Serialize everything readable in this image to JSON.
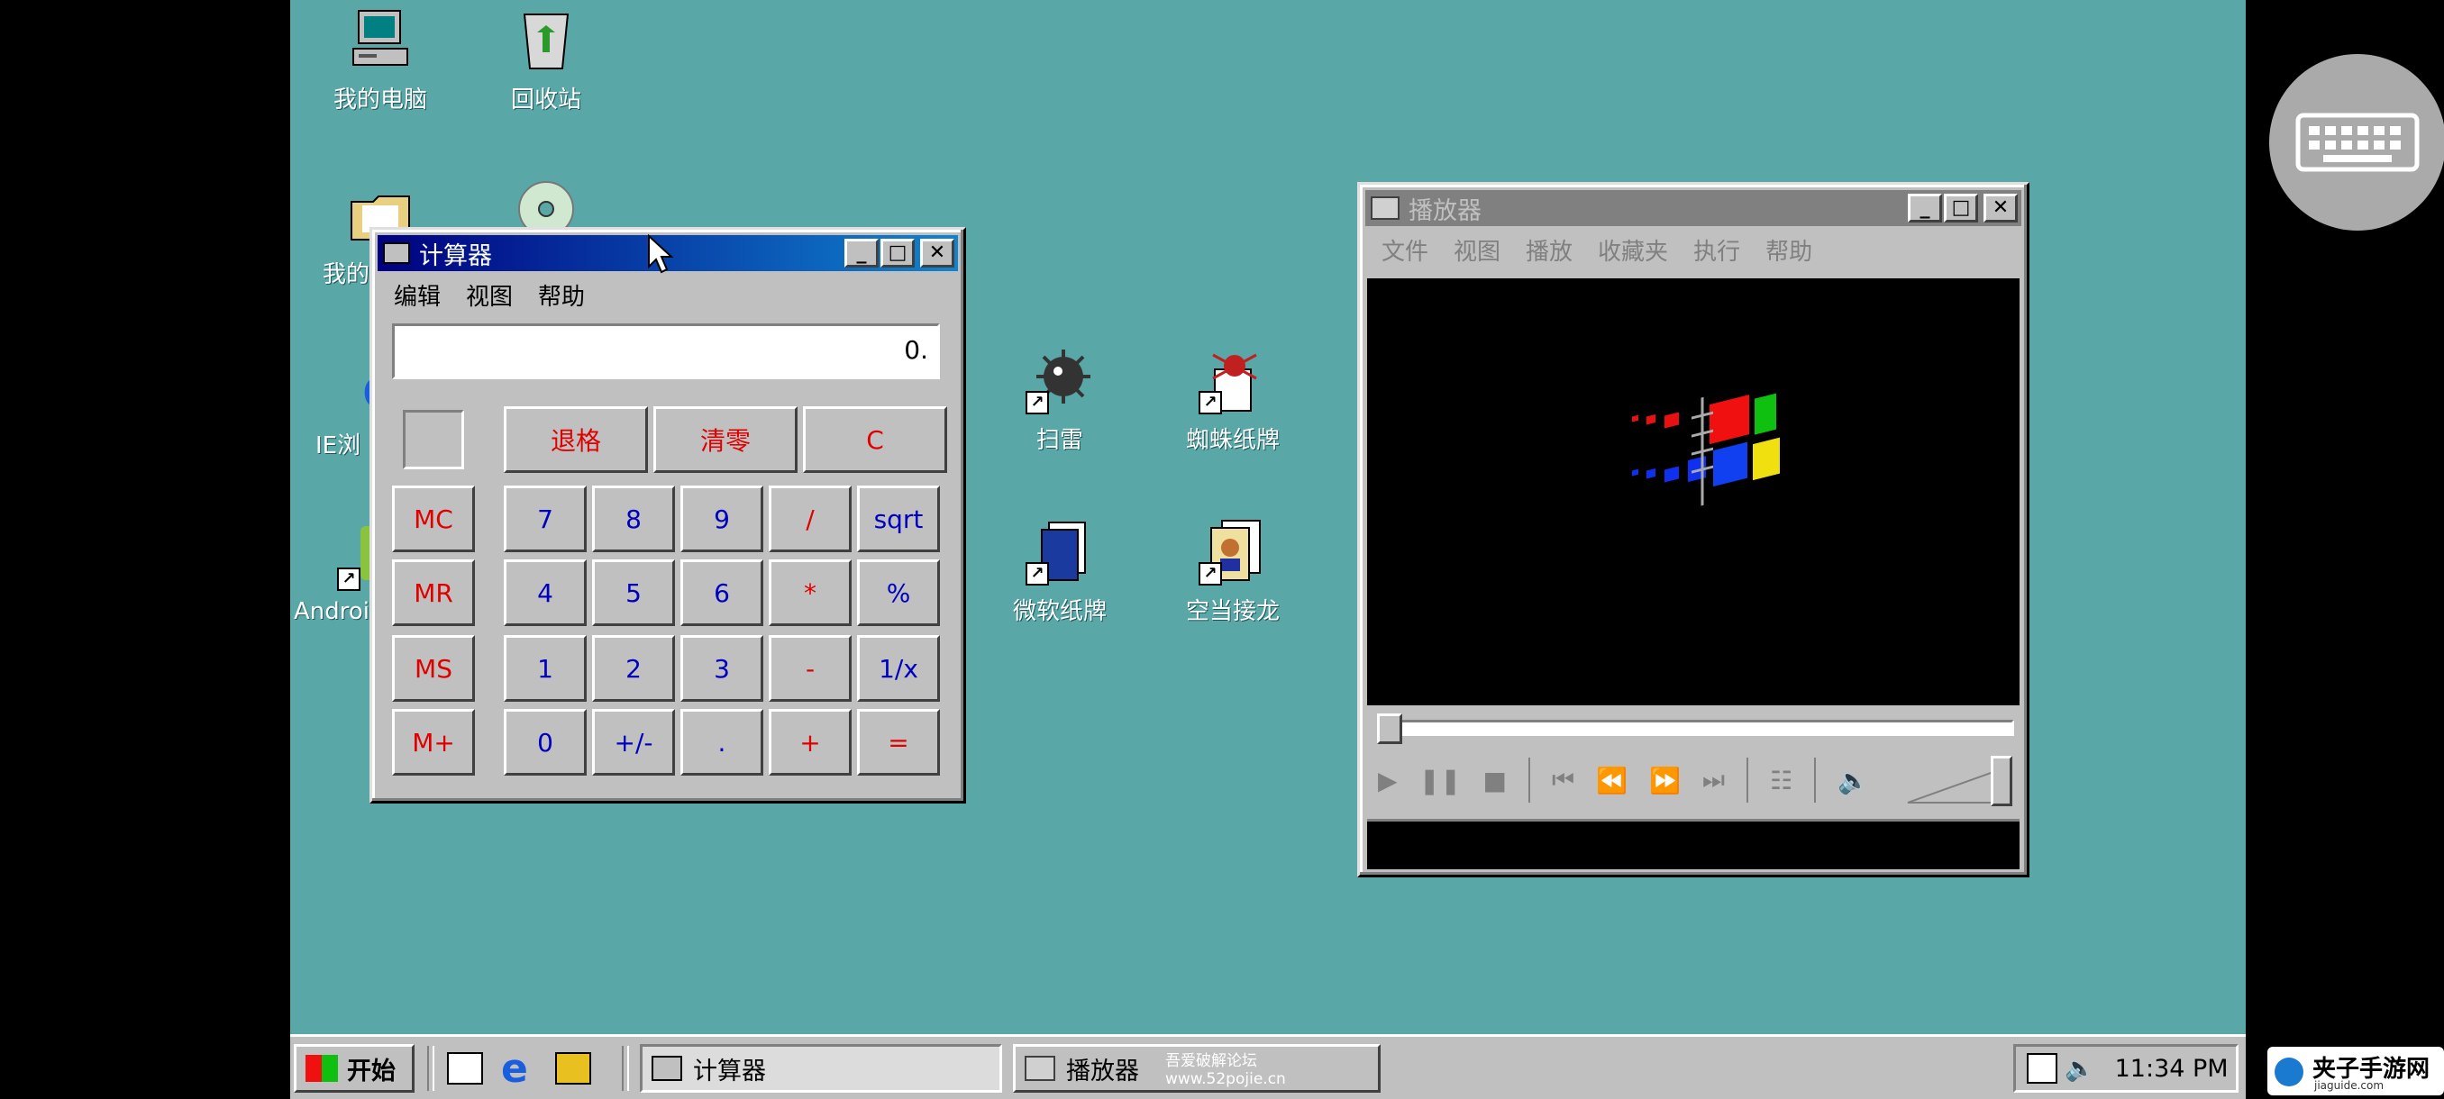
{
  "desktop": {
    "icons": [
      {
        "label": "我的电脑",
        "icon": "my-computer-icon"
      },
      {
        "label": "回收站",
        "icon": "recycle-bin-icon"
      },
      {
        "label": "我的",
        "icon": "my-documents-icon"
      },
      {
        "label": "IE浏",
        "icon": "internet-explorer-icon"
      },
      {
        "label": "Android",
        "icon": "android-icon"
      },
      {
        "label": "扫雷",
        "icon": "minesweeper-icon"
      },
      {
        "label": "蜘蛛纸牌",
        "icon": "spider-solitaire-icon"
      },
      {
        "label": "微软纸牌",
        "icon": "solitaire-icon"
      },
      {
        "label": "空当接龙",
        "icon": "freecell-icon"
      }
    ]
  },
  "calculator": {
    "title": "计算器",
    "menu": [
      "编辑",
      "视图",
      "帮助"
    ],
    "display": "0.",
    "top_buttons": [
      "退格",
      "清零",
      "C"
    ],
    "memory_buttons": [
      "MC",
      "MR",
      "MS",
      "M+"
    ],
    "keys": [
      [
        "7",
        "8",
        "9",
        "/",
        "sqrt"
      ],
      [
        "4",
        "5",
        "6",
        "*",
        "%"
      ],
      [
        "1",
        "2",
        "3",
        "-",
        "1/x"
      ],
      [
        "0",
        "+/-",
        ".",
        "+",
        "="
      ]
    ],
    "colors": {
      "digit": "#0000c0",
      "operator": "#e00000"
    }
  },
  "player": {
    "title": "播放器",
    "menu": [
      "文件",
      "视图",
      "播放",
      "收藏夹",
      "执行",
      "帮助"
    ],
    "controls": [
      "play-icon",
      "pause-icon",
      "stop-icon",
      "skip-back-icon",
      "rewind-icon",
      "fast-forward-icon",
      "skip-forward-icon",
      "playlist-icon",
      "volume-icon"
    ]
  },
  "taskbar": {
    "start_label": "开始",
    "tasks": [
      {
        "label": "计算器",
        "icon": "calculator-icon",
        "active": true
      },
      {
        "label": "播放器",
        "icon": "media-player-icon",
        "active": false
      }
    ],
    "overlay_text_1": "吾爱破解论坛",
    "overlay_text_2": "www.52pojie.cn",
    "clock": "11:34 PM"
  },
  "watermark": {
    "text_1": "夹子手游网",
    "text_2": "jiaguide.com"
  },
  "colors": {
    "desktop": "#5aa7a8",
    "title_active": "#000080",
    "face": "#c0c0c0"
  }
}
